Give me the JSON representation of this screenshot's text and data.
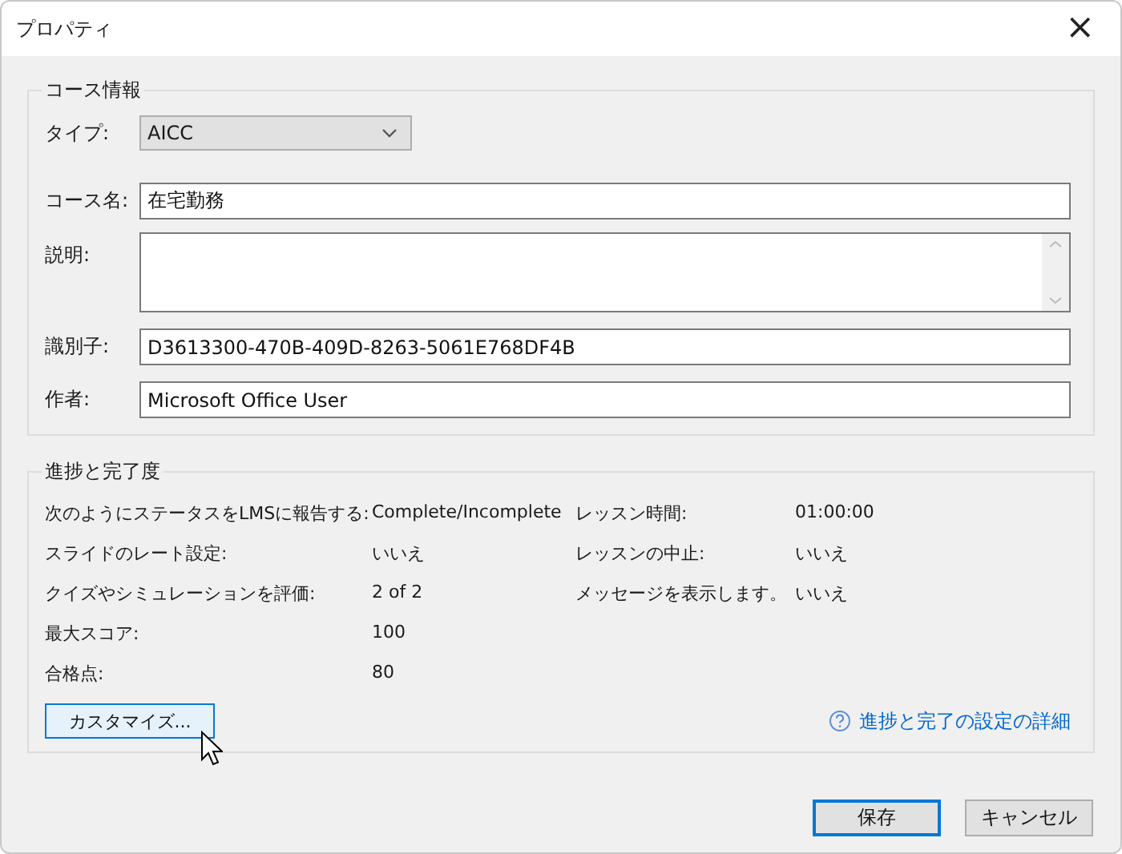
{
  "window": {
    "title": "プロパティ",
    "close": "×"
  },
  "course_info": {
    "title": "コース情報",
    "fields": [
      {
        "kind": "select",
        "label": "タイプ:",
        "value": "AICC"
      },
      {
        "kind": "text",
        "label": "コース名:",
        "value": "在宅勤務"
      },
      {
        "kind": "textarea",
        "label": "説明:"
      },
      {
        "kind": "text",
        "label": "識別子:",
        "value": "D3613300-470B-409D-8263-5061E768DF4B"
      },
      {
        "kind": "text",
        "label": "作者:",
        "value": "Microsoft Office User"
      }
    ]
  },
  "progress": {
    "title": "進捗と完了度",
    "left": [
      {
        "label": "次のようにステータスをLMSに報告する:",
        "value": "Complete/Incomplete"
      },
      {
        "label": "スライドのレート設定:",
        "value": "いいえ"
      },
      {
        "label": "クイズやシミュレーションを評価:",
        "value": "2 of 2"
      },
      {
        "label": "最大スコア:",
        "value": "100"
      },
      {
        "label": "合格点:",
        "value": "80"
      }
    ],
    "right": [
      {
        "label": "レッスン時間:",
        "value": "01:00:00"
      },
      {
        "label": "レッスンの中止:",
        "value": "いいえ"
      },
      {
        "label": "メッセージを表示します。",
        "value": "いいえ"
      }
    ],
    "customize_button": {
      "label": "カスタマイズ...",
      "hovered": true
    },
    "help_link": "進捗と完了の設定の詳細"
  },
  "buttons": [
    {
      "label": "保存",
      "default": true
    },
    {
      "label": "キャンセル",
      "default": false
    }
  ]
}
